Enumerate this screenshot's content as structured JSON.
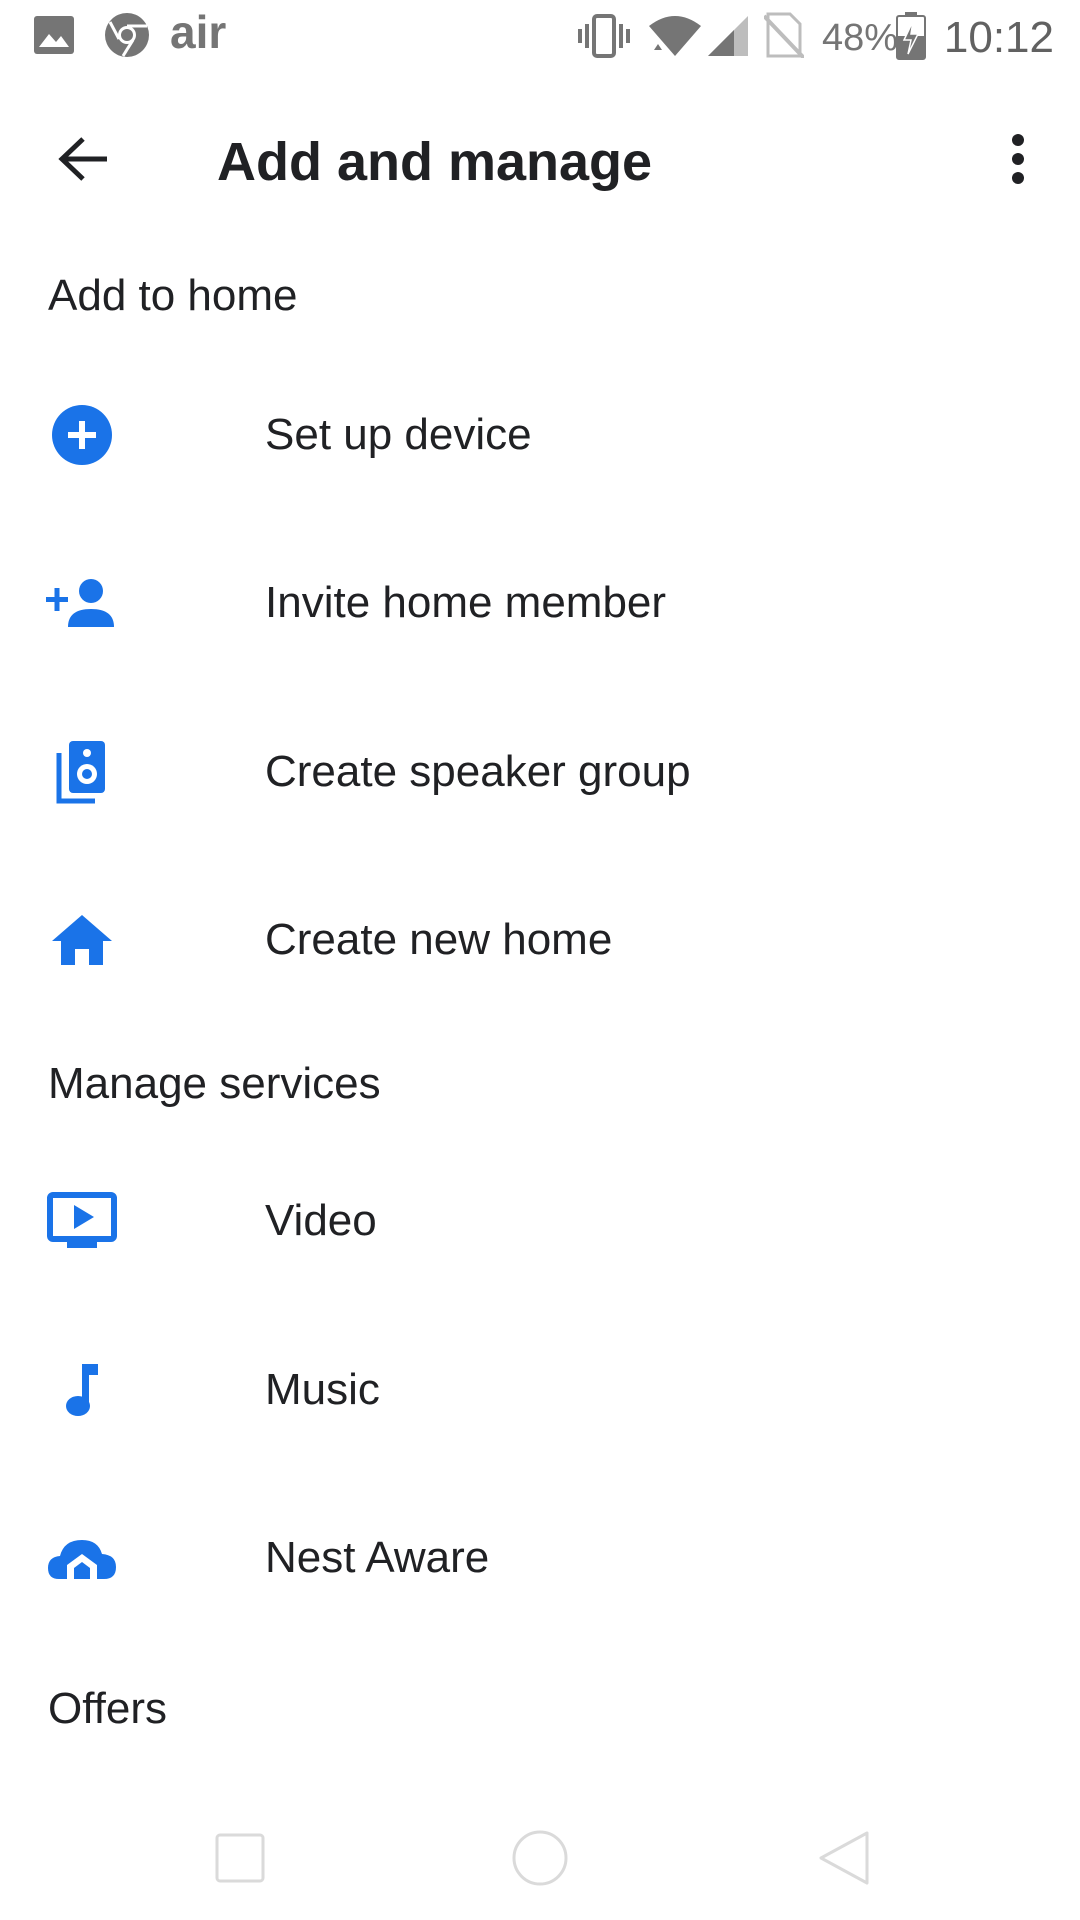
{
  "status_bar": {
    "battery": "48%",
    "time": "10:12",
    "icons": [
      "image-icon",
      "chrome-icon",
      "air-app-icon",
      "vibrate-icon",
      "wifi-icon",
      "cell-signal-icon",
      "no-sim-icon",
      "battery-charging-icon"
    ],
    "air_label": "air"
  },
  "app_bar": {
    "title": "Add and manage",
    "back_icon": "arrow-back-icon",
    "more_icon": "more-vert-icon"
  },
  "sections": {
    "add_to_home": {
      "header": "Add to home",
      "items": [
        {
          "label": "Set up device",
          "icon": "add-circle-icon"
        },
        {
          "label": "Invite home member",
          "icon": "person-add-icon"
        },
        {
          "label": "Create speaker group",
          "icon": "speaker-group-icon"
        },
        {
          "label": "Create new home",
          "icon": "home-icon"
        }
      ]
    },
    "manage_services": {
      "header": "Manage services",
      "items": [
        {
          "label": "Video",
          "icon": "video-icon"
        },
        {
          "label": "Music",
          "icon": "music-note-icon"
        },
        {
          "label": "Nest Aware",
          "icon": "nest-aware-icon"
        }
      ]
    },
    "offers": {
      "header": "Offers"
    }
  },
  "nav_bar": {
    "icons": [
      "recents-icon",
      "home-nav-icon",
      "back-nav-icon"
    ]
  },
  "colors": {
    "accent": "#1a73e8",
    "text": "#202124",
    "status": "#757575",
    "nav": "#d9d9d9"
  }
}
